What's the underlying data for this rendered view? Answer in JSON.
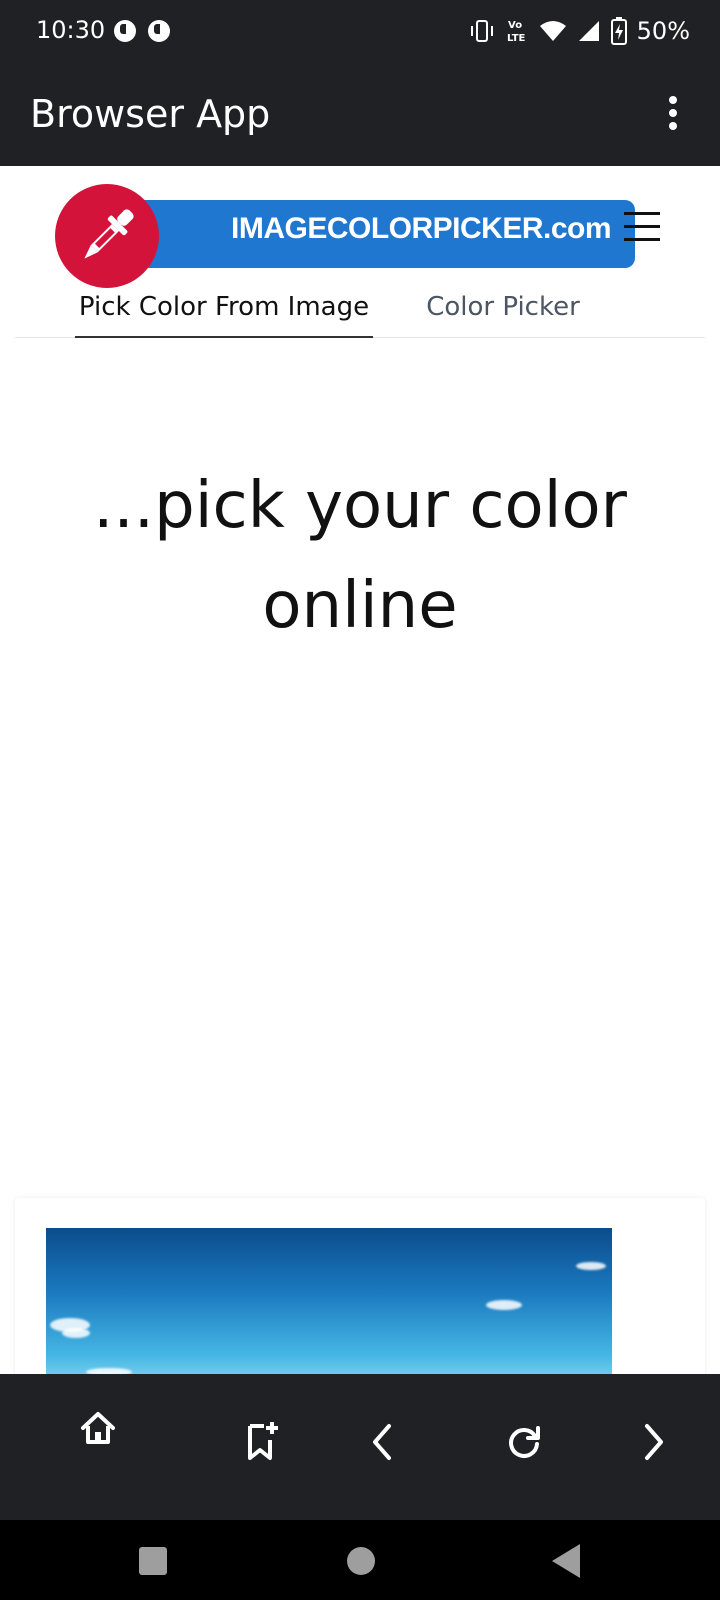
{
  "status_bar": {
    "time": "10:30",
    "left_icons": [
      "notification-icon",
      "notification-icon"
    ],
    "right_icons": [
      "vibrate-icon",
      "volte-icon",
      "wifi-icon",
      "signal-icon",
      "battery-charging-icon"
    ],
    "volte_label": "Vo\nLTE",
    "battery_percent": "50%"
  },
  "app_bar": {
    "title": "Browser App",
    "menu_icon": "overflow-menu-icon"
  },
  "site": {
    "logo_text": "IMAGECOLORPICKER.com",
    "logo_icon": "eyedropper-icon",
    "menu_icon": "hamburger-icon",
    "tabs": [
      {
        "label": "Pick Color From Image",
        "active": true
      },
      {
        "label": "Color Picker",
        "active": false
      }
    ],
    "headline": "...pick your color online",
    "image_alt": "sky-image"
  },
  "toolbar": {
    "buttons": [
      "home-icon",
      "bookmark-add-icon",
      "back-icon",
      "reload-icon",
      "forward-icon"
    ]
  },
  "colors": {
    "chrome_dark": "#202124",
    "logo_blue": "#1f77d0",
    "logo_red": "#d4133b"
  }
}
